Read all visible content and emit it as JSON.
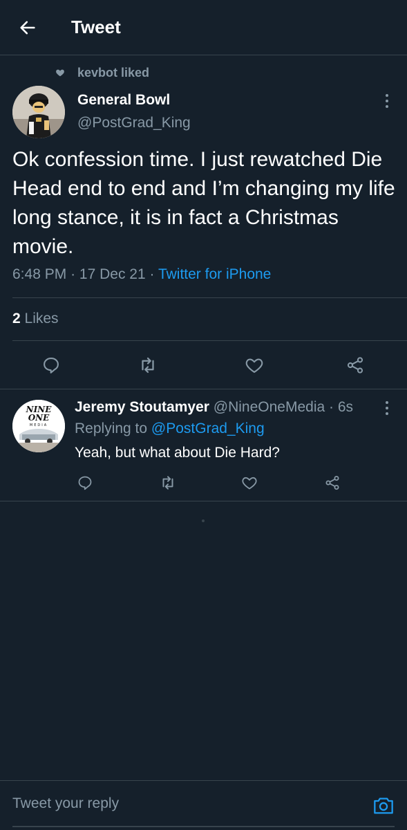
{
  "header": {
    "title": "Tweet"
  },
  "social_context": {
    "text": "kevbot liked"
  },
  "tweet": {
    "author_name": "General Bowl",
    "author_handle": "@PostGrad_King",
    "text": "Ok confession time. I just rewatched Die Head end to end and I’m changing my life long stance, it is in fact a Christmas movie.",
    "time": "6:48 PM",
    "separator": "·",
    "date": "17 Dec 21",
    "source": "Twitter for iPhone",
    "likes_count": "2",
    "likes_label": "Likes"
  },
  "reply": {
    "author_name": "Jeremy Stoutamyer",
    "author_handle": "@NineOneMedia",
    "separator": "·",
    "age": "6s",
    "replying_label": "Replying to",
    "replying_to": "@PostGrad_King",
    "text": "Yeah, but what about Die Hard?",
    "avatar_logo": {
      "line1": "NINE",
      "line2": "ONE",
      "line3": "MEDIA"
    }
  },
  "compose": {
    "placeholder": "Tweet your reply"
  },
  "icons": {
    "back": "arrow-left-icon",
    "liked": "heart-filled-icon",
    "more": "vertical-dots-icon",
    "reply": "comment-icon",
    "retweet": "retweet-icon",
    "like": "heart-icon",
    "share": "share-icon",
    "camera": "camera-icon"
  },
  "colors": {
    "background": "#15202b",
    "divider": "#38444d",
    "secondary_text": "#8899a6",
    "link": "#1d9bf0",
    "primary_text": "#ffffff"
  }
}
